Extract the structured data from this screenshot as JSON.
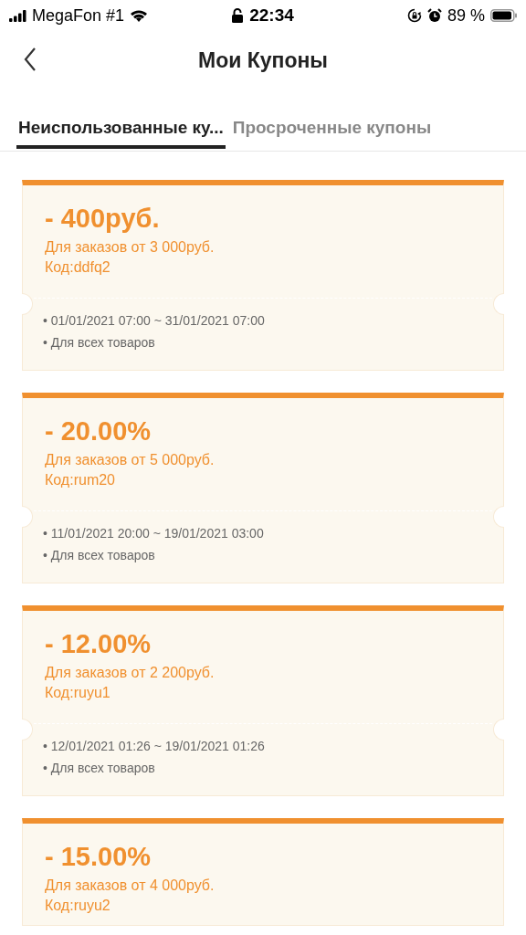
{
  "status_bar": {
    "carrier": "MegaFon #1",
    "time": "22:34",
    "battery": "89 %"
  },
  "header": {
    "title": "Мои Купоны"
  },
  "tabs": [
    {
      "label": "Неиспользованные ку...",
      "selected": true
    },
    {
      "label": "Просроченные купоны",
      "selected": false
    }
  ],
  "coupons": [
    {
      "amount": "- 400руб.",
      "condition": "Для заказов от 3 000руб.",
      "code": "Код:ddfq2",
      "details": [
        "• 01/01/2021 07:00 ~ 31/01/2021 07:00",
        "• Для всех товаров"
      ]
    },
    {
      "amount": "- 20.00%",
      "condition": "Для заказов от 5 000руб.",
      "code": "Код:rum20",
      "details": [
        "• 11/01/2021 20:00 ~ 19/01/2021 03:00",
        "• Для всех товаров"
      ]
    },
    {
      "amount": "- 12.00%",
      "condition": "Для заказов от 2 200руб.",
      "code": "Код:ruyu1",
      "details": [
        "• 12/01/2021 01:26 ~ 19/01/2021 01:26",
        "• Для всех товаров"
      ]
    },
    {
      "amount": "- 15.00%",
      "condition": "Для заказов от 4 000руб.",
      "code": "Код:ruyu2"
    }
  ]
}
